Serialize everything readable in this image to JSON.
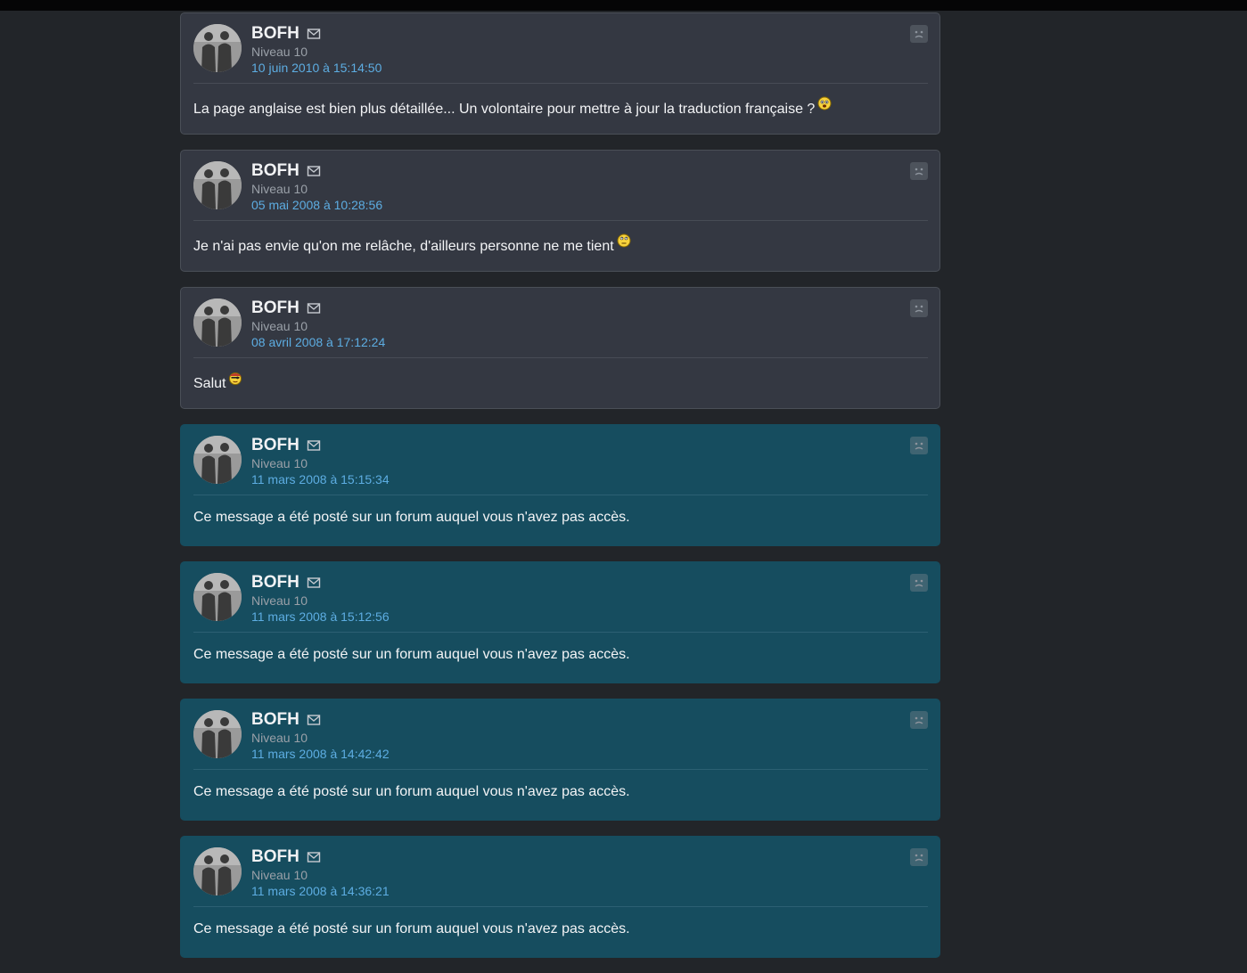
{
  "posts": [
    {
      "author": "BOFH",
      "level": "Niveau 10",
      "date": "10 juin 2010 à 15:14:50",
      "message": "La page anglaise est bien plus détaillée... Un volontaire pour mettre à jour la traduction française ?",
      "smiley": "smiley-cool-icon",
      "restricted": false
    },
    {
      "author": "BOFH",
      "level": "Niveau 10",
      "date": "05 mai 2008 à 10:28:56",
      "message": "Je n'ai pas envie qu'on me relâche, d'ailleurs personne ne me tient",
      "smiley": "smiley-eyeroll-icon",
      "restricted": false
    },
    {
      "author": "BOFH",
      "level": "Niveau 10",
      "date": "08 avril 2008 à 17:12:24",
      "message": "Salut",
      "smiley": "smiley-pirate-icon",
      "restricted": false
    },
    {
      "author": "BOFH",
      "level": "Niveau 10",
      "date": "11 mars 2008 à 15:15:34",
      "message": "Ce message a été posté sur un forum auquel vous n'avez pas accès.",
      "smiley": null,
      "restricted": true
    },
    {
      "author": "BOFH",
      "level": "Niveau 10",
      "date": "11 mars 2008 à 15:12:56",
      "message": "Ce message a été posté sur un forum auquel vous n'avez pas accès.",
      "smiley": null,
      "restricted": true
    },
    {
      "author": "BOFH",
      "level": "Niveau 10",
      "date": "11 mars 2008 à 14:42:42",
      "message": "Ce message a été posté sur un forum auquel vous n'avez pas accès.",
      "smiley": null,
      "restricted": true
    },
    {
      "author": "BOFH",
      "level": "Niveau 10",
      "date": "11 mars 2008 à 14:36:21",
      "message": "Ce message a été posté sur un forum auquel vous n'avez pas accès.",
      "smiley": null,
      "restricted": true
    }
  ],
  "colors": {
    "page_bg": "#222529",
    "post_bg": "#343842",
    "restricted_bg": "#164d5f",
    "date_link": "#5dade2"
  },
  "icons": {
    "mail": "mail-icon",
    "report": "report-icon",
    "avatar": "avatar"
  }
}
